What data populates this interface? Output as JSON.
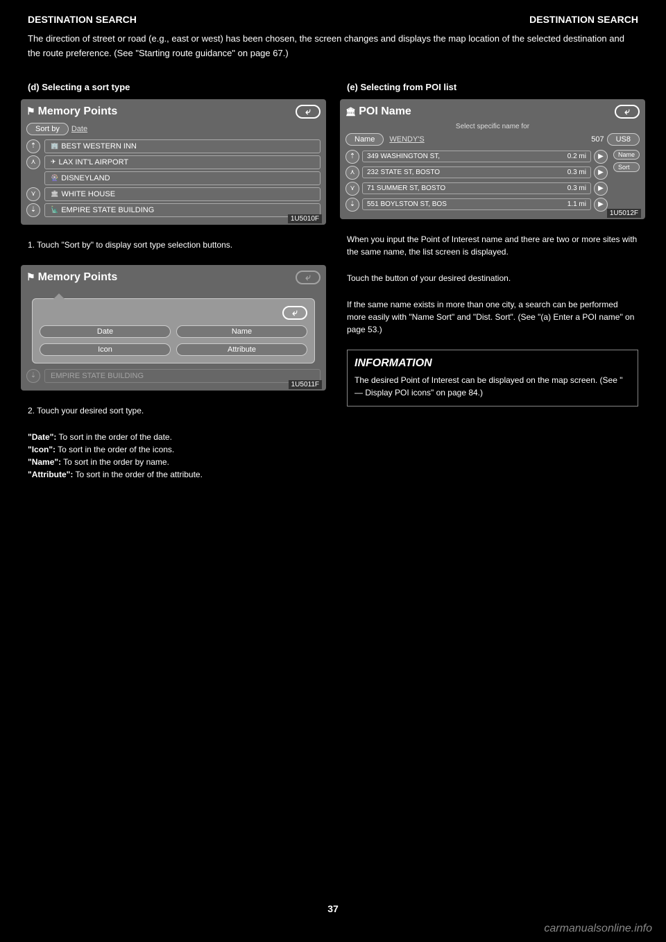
{
  "header": {
    "left": "DESTINATION SEARCH",
    "right": "DESTINATION SEARCH"
  },
  "intro": "The direction of street or road (e.g., east or west) has been chosen, the screen changes and displays the map location of the selected destination and the route preference. (See \"Starting route guidance\" on page 67.)",
  "section1_title": "(d) Selecting a sort type",
  "fig1": {
    "title": "Memory Points",
    "sort_by": "Sort by",
    "sort_label": "Date",
    "items": [
      {
        "icon": "🏢",
        "text": "BEST WESTERN INN"
      },
      {
        "icon": "✈",
        "text": "LAX INT'L AIRPORT"
      },
      {
        "icon": "🎡",
        "text": "DISNEYLAND"
      },
      {
        "icon": "🏛",
        "text": "WHITE HOUSE"
      },
      {
        "icon": "🗽",
        "text": "EMPIRE STATE BUILDING"
      }
    ],
    "label": "1U5010F"
  },
  "fig2": {
    "title": "Memory Points",
    "options": [
      "Date",
      "Name",
      "Icon",
      "Attribute"
    ],
    "dimmed_item": "EMPIRE STATE BUILDING",
    "label": "1U5011F"
  },
  "instruction1": "1. Touch \"Sort by\" to display sort type selection buttons.",
  "instruction2": "2. Touch your desired sort type.",
  "sort_desc": [
    {
      "bold": "\"Date\":",
      "text": " To sort in the order of the date."
    },
    {
      "bold": "\"Icon\":",
      "text": " To sort in the order of the icons."
    },
    {
      "bold": "\"Name\":",
      "text": " To sort in the order by name."
    },
    {
      "bold": "\"Attribute\":",
      "text": " To sort in the order of the attribute."
    }
  ],
  "section2_title": "(e) Selecting from POI list",
  "fig3": {
    "title": "POI Name",
    "subtitle": "Select specific name for",
    "name_btn": "Name",
    "search": "WENDY'S",
    "count": "507",
    "area_btn": "US8",
    "results": [
      {
        "addr": "349 WASHINGTON ST,",
        "dist": "0.2 mi"
      },
      {
        "addr": "232 STATE ST, BOSTO",
        "dist": "0.3 mi"
      },
      {
        "addr": "71 SUMMER ST, BOSTO",
        "dist": "0.3 mi"
      },
      {
        "addr": "551 BOYLSTON ST, BOS",
        "dist": "1.1 mi"
      }
    ],
    "side_btns": [
      "Name",
      "Sort"
    ],
    "label": "1U5012F"
  },
  "poi_desc1": "When you input the Point of Interest name and there are two or more sites with the same name, the list screen is displayed.",
  "poi_desc2": "Touch the button of your desired destination.",
  "poi_desc3": "If the same name exists in more than one city, a search can be performed more easily with \"Name Sort\" and \"Dist. Sort\". (See \"(a) Enter a POI name\" on page 53.)",
  "info_text": "The desired Point of Interest can be displayed on the map screen. (See \" — Display POI icons\" on page 84.)",
  "page_num": "37",
  "watermark": "carmanualsonline.info",
  "icons": {
    "up_arrow": "⇡",
    "page_up": "⋏",
    "page_down": "⋎",
    "down_arrow": "⇣",
    "back": "⤶",
    "play": "▶"
  }
}
